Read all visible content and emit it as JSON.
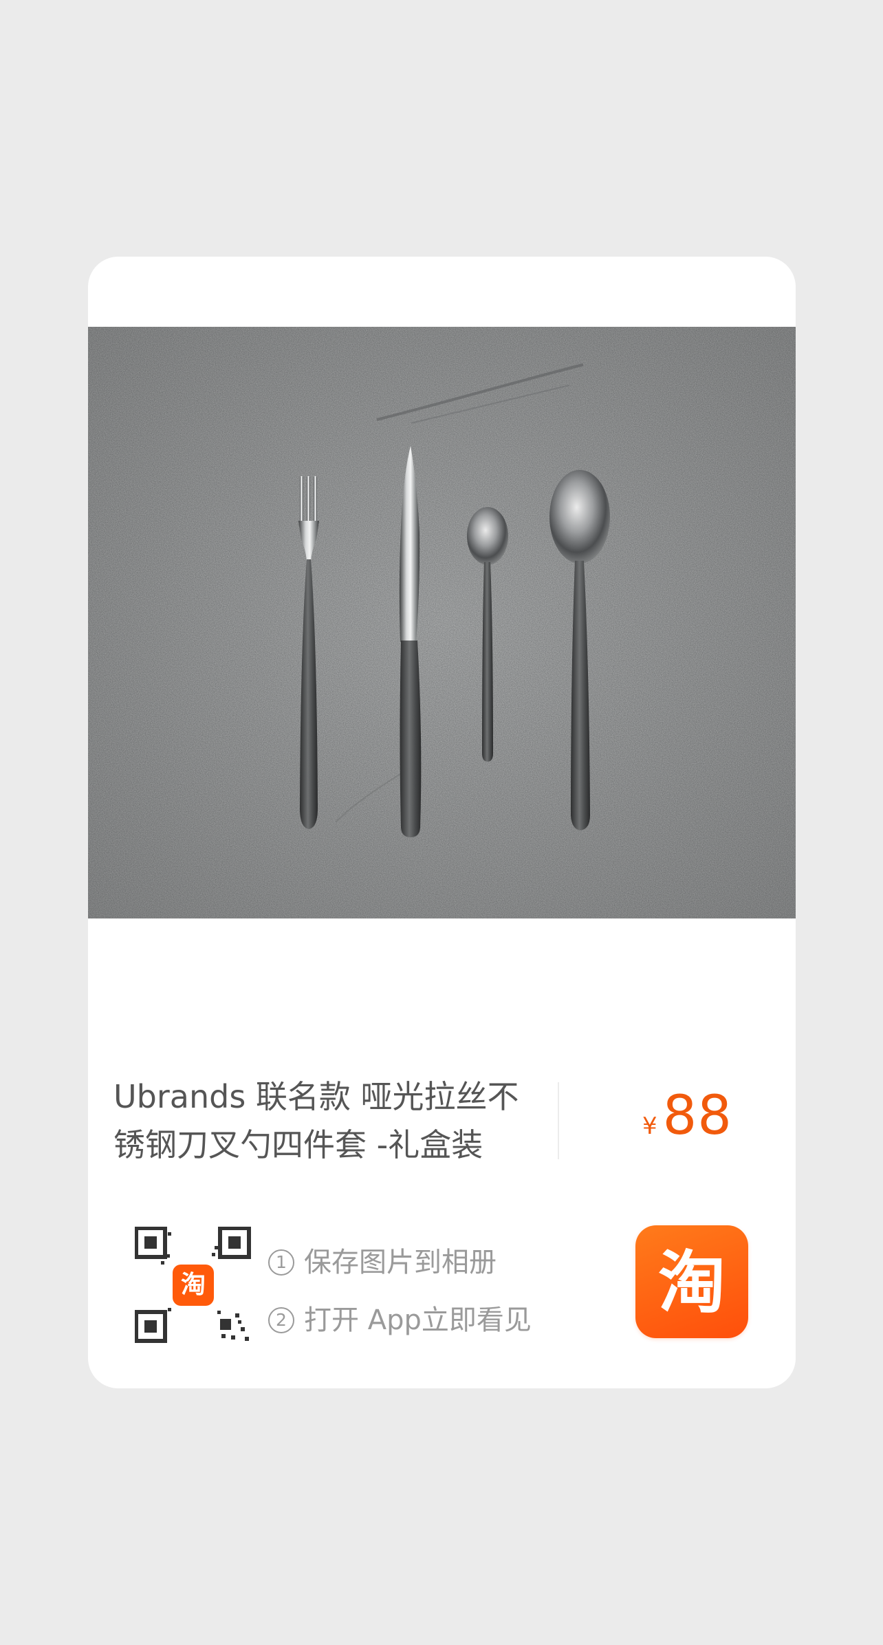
{
  "product": {
    "title": "Ubrands 联名款 哑光拉丝不锈钢刀叉勺四件套 -礼盒装",
    "image_alt": "哑光拉丝不锈钢刀叉勺四件套"
  },
  "price": {
    "currency": "¥",
    "amount": "88"
  },
  "instructions": {
    "step1_num": "1",
    "step1": "保存图片到相册",
    "step2_num": "2",
    "step2": "打开 App立即看见"
  },
  "brand": {
    "qr_logo_glyph": "淘",
    "app_glyph": "淘"
  },
  "colors": {
    "accent": "#f15a0c",
    "page_background": "#ebebeb",
    "card_background": "#ffffff",
    "concrete": "#888a89"
  }
}
